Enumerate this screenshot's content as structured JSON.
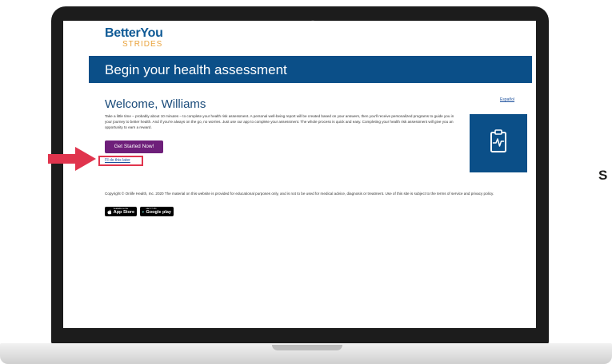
{
  "brand": {
    "top": "BetterYou",
    "bottom": "STRIDES"
  },
  "banner": {
    "title": "Begin your health assessment"
  },
  "language_link": "Español",
  "welcome": "Welcome, Williams",
  "intro_text": "Take a little time – probably about 10 minutes – to complete your health risk assessment. A personal well-being report will be created based on your answers, then you'll receive personalized programs to guide you in your journey to better health. And if you're always on the go, no worries. Just use our app to complete your assessment. The whole process is quick and easy. Completing your health risk assessment will give you an opportunity to earn a reward.",
  "cta": {
    "start": "Get Started Now!",
    "later": "I'll do this later"
  },
  "footer": {
    "copyright": "Copyright © Onlife Health, Inc. 2020 The material on this website is provided for educational purposes only, and is not to be used for medical advice, diagnosis or treatment. Use of this site is subject to the terms of service and privacy policy.",
    "appstore": {
      "small": "Available on the",
      "label": "App Store"
    },
    "googleplay": {
      "small": "GET IT ON",
      "label": "Google play"
    }
  },
  "side_letter": "S",
  "icons": {
    "tile": "clipboard-heartbeat-icon",
    "apple": "apple-icon",
    "play": "play-store-icon",
    "annotation": "arrow-right-icon"
  },
  "colors": {
    "banner": "#0b4f88",
    "button": "#6e1f7a",
    "highlight": "#e0344d",
    "logo_blue": "#0f5a96",
    "logo_orange": "#e9a23b"
  }
}
